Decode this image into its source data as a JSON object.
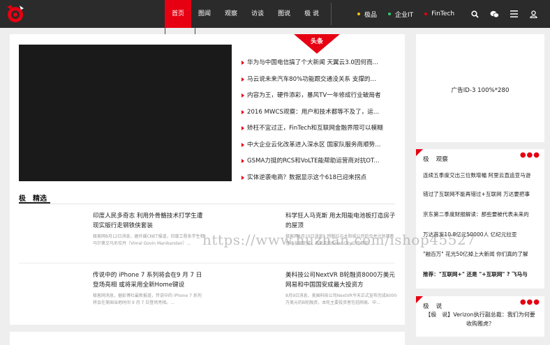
{
  "nav": {
    "items": [
      "首页",
      "图闻",
      "观察",
      "访谈",
      "图说",
      "极  说"
    ],
    "active_index": 0
  },
  "links": [
    {
      "label": "极品",
      "color": "#f5c400"
    },
    {
      "label": "企业IT",
      "color": "#2ecc71"
    },
    {
      "label": "FinTech",
      "color": "#e60012"
    }
  ],
  "ribbon": "头条",
  "headlines": [
    "华为与中国电信搞了个大新闻 天翼云3.0因何而...",
    "马云说未来汽车80%功能跟交通没关系 支撑的...",
    "内容为王，硬件添彩，暴风TV一年修成行业破局者",
    "2016 MWCS观察：用户和技术都等不及了，运...",
    "矫枉不宜过正，FinTech和互联网金融界限可以模糊",
    "中大企业云化改革进入深水区 国家队服务商顺势...",
    "GSMA力挺的RCS和VoLTE能帮助运营商对抗OT...",
    "实体逆袭电商？数据显示这个618已迎来拐点"
  ],
  "section": {
    "title_a": "极",
    "title_b": "精选"
  },
  "cards": [
    {
      "title": "印度人民多奇志 利用外骨骼技术打学生遭现实版行走钢铁侠套装",
      "desc": "极客网8月12日消息，据外媒CNET报道，印度工程系学生和马尔第文马尼坎丹（Vimal Govin Manikandan）..."
    },
    {
      "title": "科学狂人马克斯 用太阳能电池板打造房子的屋顶",
      "desc": "极客网8月10日消息，特斯拉与太阳城公司的合并计划目前已经全部完成，马斯克的Solar City公司目前..."
    },
    {
      "title": "传说中的 iPhone 7 系列将会在9 月 7 日登场亮相 或将采用全新Home键设",
      "desc": "极客网消息，据彭博社最新报道，传说中的 iPhone 7 系列将会在美国当地时间 9 月 7 日登场亮相。..."
    },
    {
      "title": "美科技公司NextVR B轮融资8000万美元 网易和中国国安成最大投资方",
      "desc": "8月9日消息，美国科技公司NextVR今天正式宣布完成8000万美元的B轮融资，本轮主要投资者包括网易、中..."
    }
  ],
  "ad": {
    "text": "广告ID-3 100%*280"
  },
  "box1": {
    "title_a": "极",
    "title_b": "观察",
    "more": "●●●",
    "items": [
      "连续五季度交出三位数增幅 阿里云直追亚马逊",
      "错过了互联网不能再错过+互联网 万达要把事",
      "京东第二季度财报解读：那些要被代表未来的",
      "万达首发10.8亿元50000人 亿纪元拉亚",
      "\"融百万\" 花光50亿掉上大新闻 你们真的了解"
    ],
    "rec": "推荐：\"互联网+\" 还是 \"+互联网\" ? 飞马与"
  },
  "box2": {
    "title_a": "极",
    "title_b": "说",
    "more": "●●●",
    "text": "【极　说】Verizon执行副总裁：我们为何要收购雅虎？"
  },
  "watermark": "https://www.huzhan.com/ishop45527",
  "colors": {
    "accent": "#e60012",
    "header": "#2b2b2b",
    "background": "#eeeeee"
  }
}
